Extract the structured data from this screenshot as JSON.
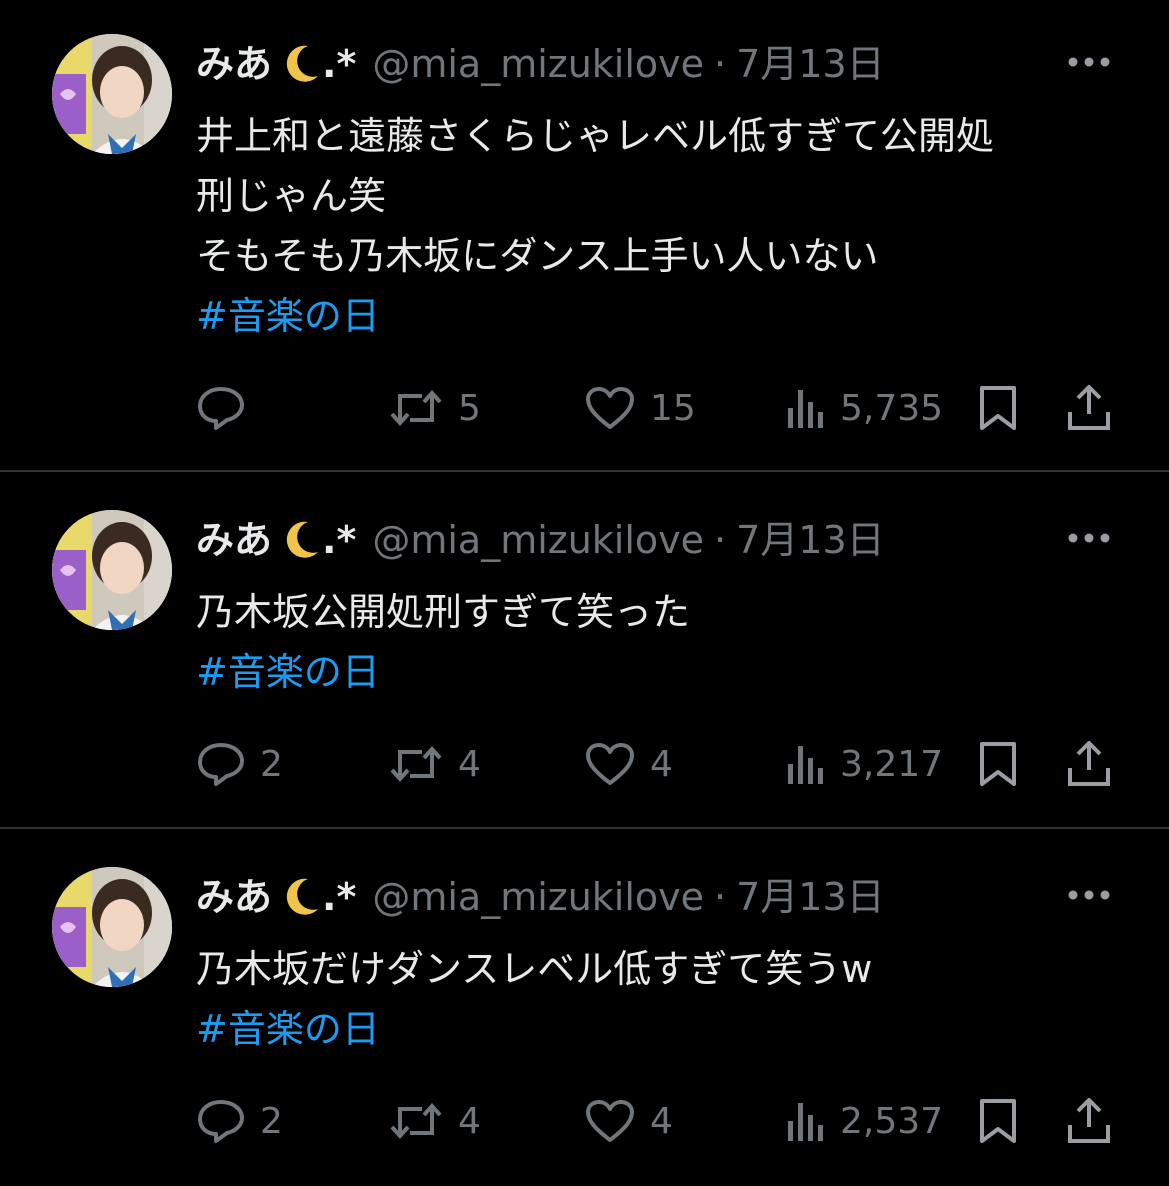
{
  "colors": {
    "background": "#000000",
    "text": "#e7e9ea",
    "secondary": "#71767b",
    "hashtag": "#1d9bf0",
    "divider": "#2f3336"
  },
  "tweets": [
    {
      "name": "みあ",
      "name_suffix": ".*",
      "handle": "@mia_mizukilove",
      "separator": "·",
      "date": "7月13日",
      "lines": [
        "井上和と遠藤さくらじゃレベル低すぎて公開処",
        "刑じゃん笑",
        "そもそも乃木坂にダンス上手い人いない"
      ],
      "hashtag": "#音楽の日",
      "replies": "",
      "retweets": "5",
      "likes": "15",
      "views": "5,735",
      "icons": [
        "reply-icon",
        "retweet-icon",
        "like-icon",
        "views-icon",
        "bookmark-icon",
        "share-icon",
        "more-icon"
      ]
    },
    {
      "name": "みあ",
      "name_suffix": ".*",
      "handle": "@mia_mizukilove",
      "separator": "·",
      "date": "7月13日",
      "lines": [
        "乃木坂公開処刑すぎて笑った"
      ],
      "hashtag": "#音楽の日",
      "replies": "2",
      "retweets": "4",
      "likes": "4",
      "views": "3,217",
      "icons": [
        "reply-icon",
        "retweet-icon",
        "like-icon",
        "views-icon",
        "bookmark-icon",
        "share-icon",
        "more-icon"
      ]
    },
    {
      "name": "みあ",
      "name_suffix": ".*",
      "handle": "@mia_mizukilove",
      "separator": "·",
      "date": "7月13日",
      "lines": [
        "乃木坂だけダンスレベル低すぎて笑うw"
      ],
      "hashtag": "#音楽の日",
      "replies": "2",
      "retweets": "4",
      "likes": "4",
      "views": "2,537",
      "icons": [
        "reply-icon",
        "retweet-icon",
        "like-icon",
        "views-icon",
        "bookmark-icon",
        "share-icon",
        "more-icon"
      ]
    }
  ]
}
